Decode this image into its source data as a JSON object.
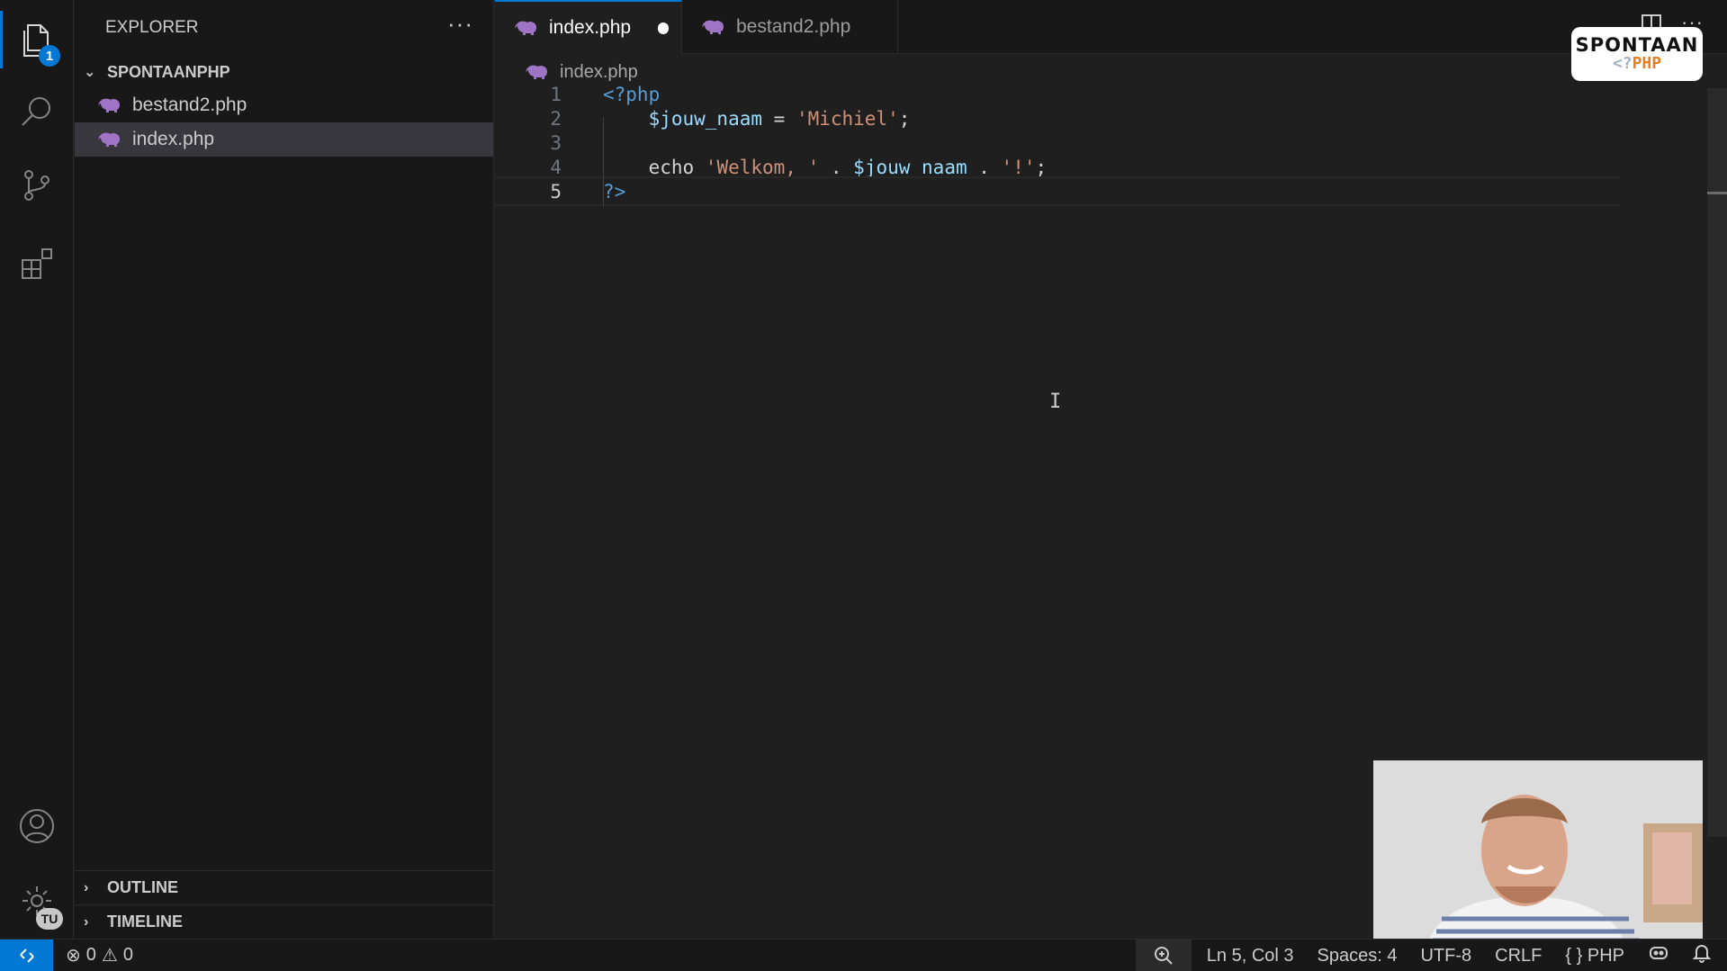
{
  "activity_bar": {
    "explorer_badge": "1",
    "account_badge": "TU"
  },
  "sidebar": {
    "title": "EXPLORER",
    "more": "···",
    "folder": "SPONTAANPHP",
    "files": [
      {
        "name": "bestand2.php",
        "selected": false
      },
      {
        "name": "index.php",
        "selected": true
      }
    ],
    "outline": "OUTLINE",
    "timeline": "TIMELINE"
  },
  "tabs": [
    {
      "label": "index.php",
      "active": true,
      "modified": true
    },
    {
      "label": "bestand2.php",
      "active": false,
      "modified": false
    }
  ],
  "breadcrumb": "index.php",
  "editor": {
    "line_numbers": [
      "1",
      "2",
      "3",
      "4",
      "5"
    ],
    "current_line": 5,
    "lines": [
      [
        {
          "t": "php",
          "v": "<?php"
        }
      ],
      [
        {
          "t": "var",
          "v": "    $jouw_naam"
        },
        {
          "t": "op",
          "v": " = "
        },
        {
          "t": "str",
          "v": "'Michiel'"
        },
        {
          "t": "op",
          "v": ";"
        }
      ],
      [],
      [
        {
          "t": "kw",
          "v": "    echo "
        },
        {
          "t": "str",
          "v": "'Welkom, '"
        },
        {
          "t": "op",
          "v": " . "
        },
        {
          "t": "var",
          "v": "$jouw_naam"
        },
        {
          "t": "op",
          "v": " . "
        },
        {
          "t": "str",
          "v": "'!'"
        },
        {
          "t": "op",
          "v": ";"
        }
      ],
      [
        {
          "t": "php",
          "v": "?>"
        }
      ]
    ]
  },
  "logo": {
    "top": "SPONTAAN",
    "bottom_prefix": "<?",
    "bottom": "PHP"
  },
  "statusbar": {
    "errors": "0",
    "warnings": "0",
    "position": "Ln 5, Col 3",
    "spaces": "Spaces: 4",
    "encoding": "UTF-8",
    "eol": "CRLF",
    "language": "PHP"
  },
  "colors": {
    "accent": "#0078d4",
    "php_icon": "#a074c4",
    "string": "#ce9178",
    "variable": "#9cdcfe",
    "keyword_php": "#569cd6"
  }
}
